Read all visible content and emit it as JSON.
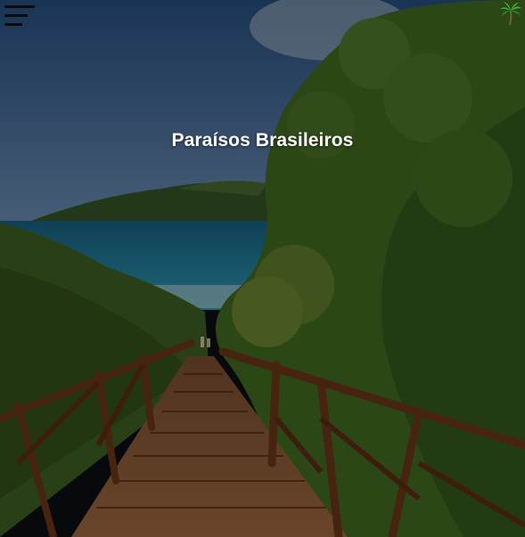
{
  "header": {
    "menu_icon": "hamburger-menu-icon",
    "logo_icon": "palm-tree-icon"
  },
  "hero": {
    "title": "Paraísos Brasileiros",
    "overlay_color": "#000000",
    "overlay_opacity": 0.42
  },
  "colors": {
    "sky": "#4a74a8",
    "sea": "#1f8fb5",
    "foliage": "#4f7a2a",
    "wood": "#8a4a25",
    "title_text": "#ffffff"
  }
}
